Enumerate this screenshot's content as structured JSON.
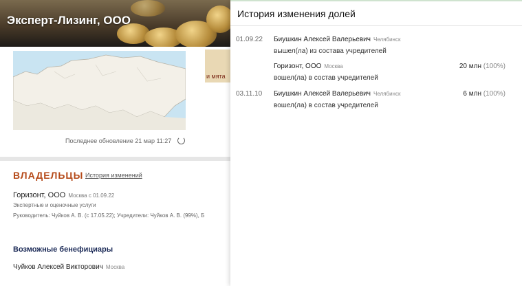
{
  "company": {
    "title": "Эксперт-Лизинг, ООО"
  },
  "map": {
    "updated_text": "Последнее обновление 21 мар 11:27"
  },
  "thumbnail": {
    "text": "и мята"
  },
  "owners": {
    "title": "ВЛАДЕЛЬЦЫ",
    "history_link": "История изменений",
    "items": [
      {
        "name": "Горизонт, ООО",
        "meta": "Москва  с 01.09.22",
        "activity": "Экспертные и оценочные услуги",
        "management": "Руководитель: Чуйков А. В. (с 17.05.22); Учредители: Чуйков А. В. (99%), Б"
      }
    ]
  },
  "beneficiaries": {
    "title": "Возможные бенефициары",
    "items": [
      {
        "name": "Чуйков Алексей Викторович",
        "city": "Москва"
      }
    ]
  },
  "history_panel": {
    "title": "История изменения долей",
    "entries": [
      {
        "date": "01.09.22",
        "person": "Биушкин Алексей Валерьевич",
        "city": "Челябинск",
        "action": "вышел(ла) из состава учредителей",
        "amount": "",
        "pct": ""
      },
      {
        "date": "",
        "person": "Горизонт, ООО",
        "city": "Москва",
        "action": "вошел(ла) в состав учредителей",
        "amount": "20 млн",
        "pct": "(100%)"
      },
      {
        "date": "03.11.10",
        "person": "Биушкин Алексей Валерьевич",
        "city": "Челябинск",
        "action": "вошел(ла) в состав учредителей",
        "amount": "6 млн",
        "pct": "(100%)"
      }
    ]
  },
  "colors": {
    "accent": "#b54a19",
    "heading_blue": "#1b2a57",
    "map_water": "#c9e4f2"
  }
}
